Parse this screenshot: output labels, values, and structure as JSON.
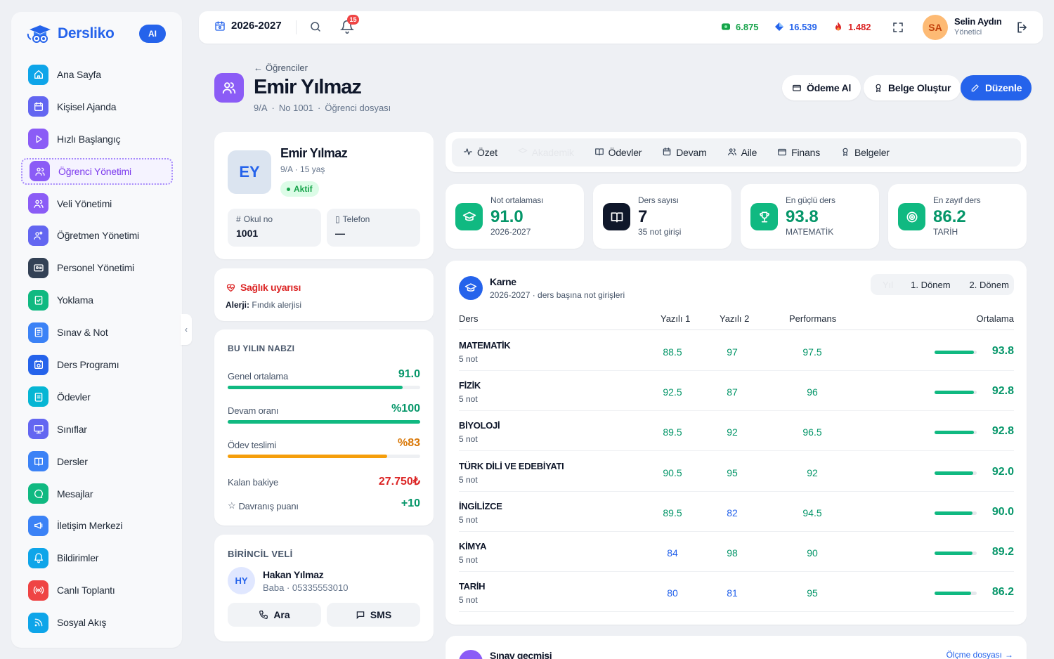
{
  "brand": {
    "name": "Dersliko",
    "ai_badge": "AI"
  },
  "sidebar": {
    "items": [
      {
        "label": "Ana Sayfa",
        "color": "#0ea5e9",
        "icon": "home-icon"
      },
      {
        "label": "Kişisel Ajanda",
        "color": "#6366f1",
        "icon": "calendar-icon"
      },
      {
        "label": "Hızlı Başlangıç",
        "color": "#8b5cf6",
        "icon": "play-icon"
      },
      {
        "label": "Öğrenci Yönetimi",
        "color": "#8b5cf6",
        "icon": "users-icon"
      },
      {
        "label": "Veli Yönetimi",
        "color": "#8b5cf6",
        "icon": "users-icon"
      },
      {
        "label": "Öğretmen Yönetimi",
        "color": "#6366f1",
        "icon": "user-group-icon"
      },
      {
        "label": "Personel Yönetimi",
        "color": "#334155",
        "icon": "id-card-icon"
      },
      {
        "label": "Yoklama",
        "color": "#10b981",
        "icon": "clipboard-check-icon"
      },
      {
        "label": "Sınav & Not",
        "color": "#3b82f6",
        "icon": "document-icon"
      },
      {
        "label": "Ders Programı",
        "color": "#2563eb",
        "icon": "calendar-clock-icon"
      },
      {
        "label": "Ödevler",
        "color": "#06b6d4",
        "icon": "clipboard-icon"
      },
      {
        "label": "Sınıflar",
        "color": "#6366f1",
        "icon": "monitor-icon"
      },
      {
        "label": "Dersler",
        "color": "#3b82f6",
        "icon": "book-icon"
      },
      {
        "label": "Mesajlar",
        "color": "#10b981",
        "icon": "chat-icon"
      },
      {
        "label": "İletişim Merkezi",
        "color": "#3b82f6",
        "icon": "megaphone-icon"
      },
      {
        "label": "Bildirimler",
        "color": "#0ea5e9",
        "icon": "bell-icon"
      },
      {
        "label": "Canlı Toplantı",
        "color": "#ef4444",
        "icon": "broadcast-icon"
      },
      {
        "label": "Sosyal Akış",
        "color": "#0ea5e9",
        "icon": "rss-icon"
      }
    ],
    "active_index": 3
  },
  "topbar": {
    "year": "2026-2027",
    "notif_count": "15",
    "coins": [
      {
        "value": "6.875",
        "color": "#16a34a",
        "icon": "cash-icon"
      },
      {
        "value": "16.539",
        "color": "#2563eb",
        "icon": "gem-icon"
      },
      {
        "value": "1.482",
        "color": "#dc2626",
        "icon": "flame-icon"
      }
    ],
    "user": {
      "initials": "SA",
      "name": "Selin Aydın",
      "role": "Yönetici"
    }
  },
  "header": {
    "breadcrumb": "Öğrenciler",
    "name": "Emir Yılmaz",
    "class": "9/A",
    "no": "No 1001",
    "file": "Öğrenci dosyası",
    "buttons": {
      "payment": "Ödeme Al",
      "document": "Belge Oluştur",
      "edit": "Düzenle"
    }
  },
  "profile": {
    "initials": "EY",
    "name": "Emir Yılmaz",
    "class_age": "9/A · 15 yaş",
    "status": "Aktif",
    "school_no_label": "Okul no",
    "school_no": "1001",
    "phone_label": "Telefon",
    "phone": "—"
  },
  "health": {
    "title": "Sağlık uyarısı",
    "label": "Alerji:",
    "value": "Fındık alerjisi"
  },
  "pulse": {
    "title": "BU YILIN NABZI",
    "metrics": [
      {
        "label": "Genel ortalama",
        "value": "91.0",
        "pct": 91,
        "color": "#10b981",
        "text_color": "#059669"
      },
      {
        "label": "Devam oranı",
        "value": "%100",
        "pct": 100,
        "color": "#10b981",
        "text_color": "#059669"
      },
      {
        "label": "Ödev teslimi",
        "value": "%83",
        "pct": 83,
        "color": "#f59e0b",
        "text_color": "#d97706"
      }
    ],
    "balance_label": "Kalan bakiye",
    "balance": "27.750₺",
    "behavior_label": "Davranış puanı",
    "behavior": "+10"
  },
  "parent": {
    "title": "BİRİNCİL VELİ",
    "initials": "HY",
    "name": "Hakan Yılmaz",
    "sub": "Baba · 05335553010",
    "call": "Ara",
    "sms": "SMS"
  },
  "tabs": [
    {
      "label": "Özet",
      "icon": "activity-icon"
    },
    {
      "label": "Akademik",
      "icon": "grad-icon",
      "ghost": true
    },
    {
      "label": "Ödevler",
      "icon": "book-open-icon"
    },
    {
      "label": "Devam",
      "icon": "calendar-icon"
    },
    {
      "label": "Aile",
      "icon": "users-icon"
    },
    {
      "label": "Finans",
      "icon": "wallet-icon"
    },
    {
      "label": "Belgeler",
      "icon": "award-icon"
    }
  ],
  "stats": [
    {
      "label": "Not ortalaması",
      "value": "91.0",
      "sub": "2026-2027",
      "icon_bg": "#10b981",
      "value_color": "#059669",
      "icon": "graduation-cap-icon"
    },
    {
      "label": "Ders sayısı",
      "value": "7",
      "sub": "35 not girişi",
      "icon_bg": "#0f172a",
      "value_color": "#0f172a",
      "icon": "book-open-icon"
    },
    {
      "label": "En güçlü ders",
      "value": "93.8",
      "sub": "MATEMATİK",
      "icon_bg": "#10b981",
      "value_color": "#059669",
      "icon": "trophy-icon"
    },
    {
      "label": "En zayıf ders",
      "value": "86.2",
      "sub": "TARİH",
      "icon_bg": "#10b981",
      "value_color": "#059669",
      "icon": "target-icon"
    }
  ],
  "karne": {
    "title": "Karne",
    "subtitle": "2026-2027 · ders başına not girişleri",
    "segments": [
      "Yıl",
      "1. Dönem",
      "2. Dönem"
    ],
    "columns": [
      "Ders",
      "Yazılı 1",
      "Yazılı 2",
      "Performans",
      "Ortalama"
    ],
    "rows": [
      {
        "name": "MATEMATİK",
        "count": "5 not",
        "y1": "88.5",
        "y2": "97",
        "perf": "97.5",
        "avg": "93.8",
        "pct": 93.8
      },
      {
        "name": "FİZİK",
        "count": "5 not",
        "y1": "92.5",
        "y2": "87",
        "perf": "96",
        "avg": "92.8",
        "pct": 92.8
      },
      {
        "name": "BİYOLOJİ",
        "count": "5 not",
        "y1": "89.5",
        "y2": "92",
        "perf": "96.5",
        "avg": "92.8",
        "pct": 92.8
      },
      {
        "name": "TÜRK DİLİ VE EDEBİYATI",
        "count": "5 not",
        "y1": "90.5",
        "y2": "95",
        "perf": "92",
        "avg": "92.0",
        "pct": 92.0
      },
      {
        "name": "İNGİLİZCE",
        "count": "5 not",
        "y1": "89.5",
        "y2": "82",
        "perf": "94.5",
        "avg": "90.0",
        "pct": 90.0
      },
      {
        "name": "KİMYA",
        "count": "5 not",
        "y1": "84",
        "y2": "98",
        "perf": "90",
        "avg": "89.2",
        "pct": 89.2
      },
      {
        "name": "TARİH",
        "count": "5 not",
        "y1": "80",
        "y2": "81",
        "perf": "95",
        "avg": "86.2",
        "pct": 86.2
      }
    ]
  },
  "exam_history": {
    "title": "Sınav geçmişi",
    "link": "Ölçme dosyası"
  }
}
